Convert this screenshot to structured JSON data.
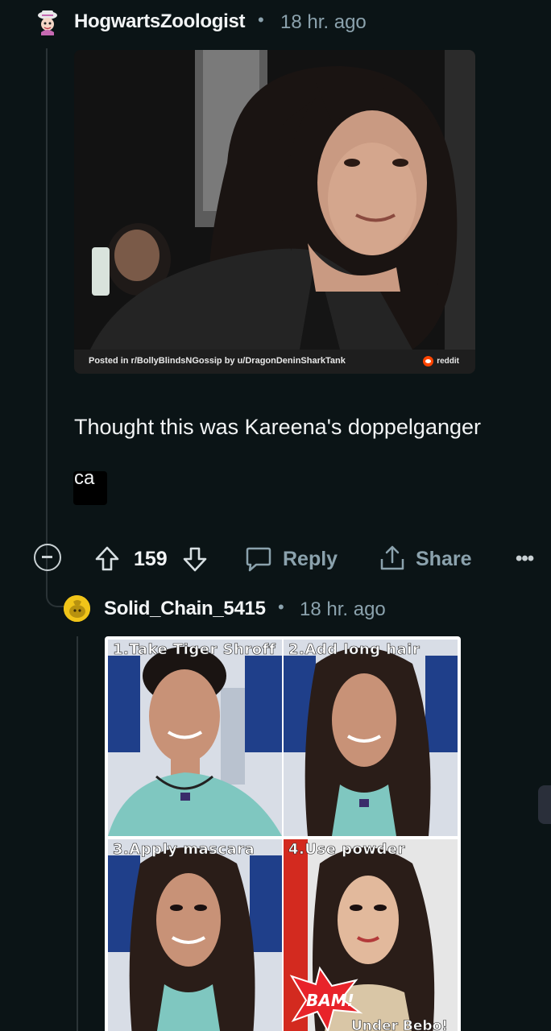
{
  "comment1": {
    "username": "HogwartsZoologist",
    "separator": "•",
    "time": "18 hr. ago",
    "image_caption": "Posted in r/BollyBlindsNGossip by u/DragonDeninSharkTank",
    "image_brand": "reddit",
    "body": "Thought this was Kareena's doppelganger",
    "mini_text": "ca"
  },
  "actions": {
    "vote_count": "159",
    "reply_label": "Reply",
    "share_label": "Share",
    "more_label": "•••"
  },
  "comment2": {
    "username": "Solid_Chain_5415",
    "separator": "•",
    "time": "18 hr. ago",
    "meme": {
      "panels": [
        "1.Take Tiger Shroff",
        "2.Add long hair",
        "3.Apply mascara",
        "4.Use powder"
      ],
      "bam": "BAM!",
      "bottom_caption": "Under Bebo!"
    }
  },
  "icons": {
    "collapse": "minus-circle-icon",
    "upvote": "arrow-up-icon",
    "downvote": "arrow-down-icon",
    "reply": "speech-bubble-icon",
    "share": "share-upload-icon",
    "more": "ellipsis-icon"
  },
  "colors": {
    "background": "#0b1416",
    "muted_text": "#8ba2ad",
    "reddit_orange": "#ff4500"
  }
}
